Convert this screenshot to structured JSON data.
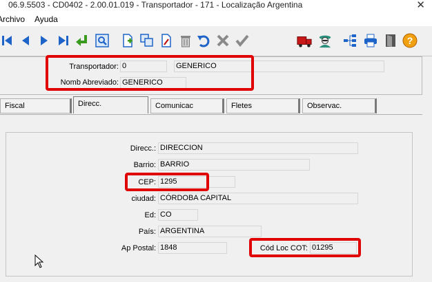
{
  "window": {
    "title": "06.9.5503 - CD0402 - 2.00.01.019 - Transportador - 171 - Localização Argentina",
    "close_glyph": "✕"
  },
  "menu": {
    "items": [
      "Archivo",
      "Ayuda"
    ]
  },
  "toolbar": {
    "icons": [
      "first-record-icon",
      "previous-record-icon",
      "next-record-icon",
      "last-record-icon",
      "goto-icon",
      "search-zoom-icon",
      "new-document-icon",
      "copy-icon",
      "edit-document-icon",
      "trash-icon",
      "undo-icon",
      "cancel-icon",
      "confirm-icon",
      "truck-icon",
      "user-spy-icon",
      "tree-icon",
      "printer-icon",
      "exit-door-icon",
      "help-icon"
    ]
  },
  "header": {
    "transportador_label": "Transportador:",
    "transportador_code": "0",
    "transportador_name": "GENERICO",
    "nomb_abreviado_label": "Nomb Abreviado:",
    "nomb_abreviado_value": "GENERICO"
  },
  "tabs": [
    {
      "label": "Fiscal"
    },
    {
      "label": "Direcc."
    },
    {
      "label": "Comunicac"
    },
    {
      "label": "Fletes"
    },
    {
      "label": "Observac."
    }
  ],
  "form": {
    "direcc_label": "Direcc.:",
    "direcc_value": "DIRECCION",
    "barrio_label": "Barrio:",
    "barrio_value": "BARRIO",
    "cep_label": "CEP:",
    "cep_value": "1295",
    "ciudad_label": "ciudad:",
    "ciudad_value": "CÓRDOBA CAPITAL",
    "ed_label": "Ed:",
    "ed_value": "CO",
    "pais_label": "País:",
    "pais_value": "ARGENTINA",
    "ap_postal_label": "Ap Postal:",
    "ap_postal_value": "1848",
    "cod_loc_cot_label": "Cód Loc COT:",
    "cod_loc_cot_value": "01295"
  },
  "colors": {
    "highlight": "#e00000",
    "accent_blue": "#1e64c8"
  }
}
